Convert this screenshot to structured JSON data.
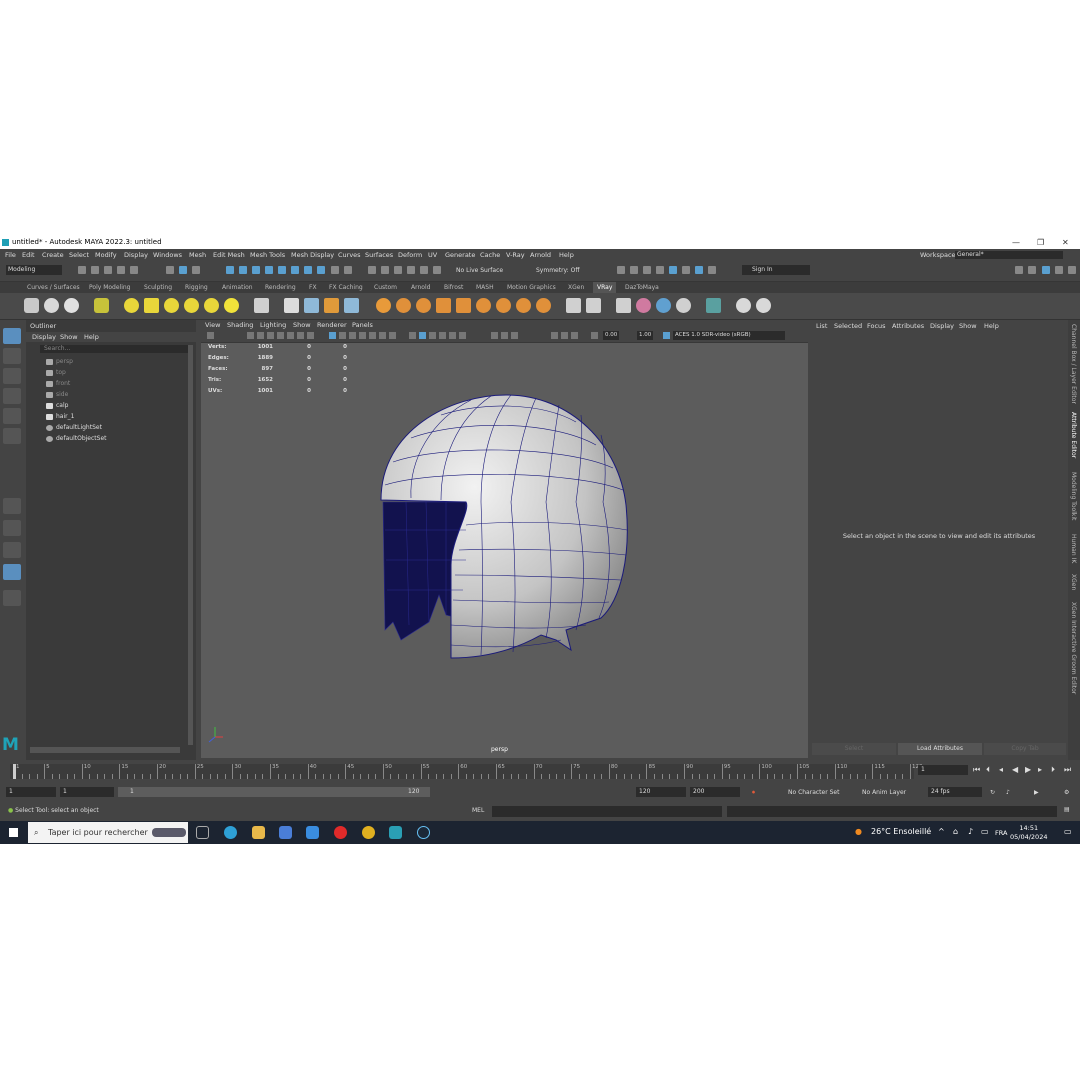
{
  "window": {
    "title": "untitled* - Autodesk MAYA 2022.3: untitled"
  },
  "menubar": {
    "items": [
      "File",
      "Edit",
      "Create",
      "Select",
      "Modify",
      "Display",
      "Windows",
      "Mesh",
      "Edit Mesh",
      "Mesh Tools",
      "Mesh Display",
      "Curves",
      "Surfaces",
      "Deform",
      "UV",
      "Generate",
      "Cache",
      "V-Ray",
      "Arnold",
      "Help"
    ],
    "workspace_label": "Workspace:",
    "workspace_value": "General*"
  },
  "statusline": {
    "mode": "Modeling",
    "live_surface": "No Live Surface",
    "symmetry": "Symmetry: Off",
    "sign_in": "Sign In"
  },
  "shelf": {
    "tabs": [
      "Curves / Surfaces",
      "Poly Modeling",
      "Sculpting",
      "Rigging",
      "Animation",
      "Rendering",
      "FX",
      "FX Caching",
      "Custom",
      "Arnold",
      "Bifrost",
      "MASH",
      "Motion Graphics",
      "XGen",
      "VRay",
      "DazToMaya"
    ],
    "active_tab": "VRay"
  },
  "outliner": {
    "title": "Outliner",
    "menu": [
      "Display",
      "Show",
      "Help"
    ],
    "search_placeholder": "Search...",
    "items": [
      {
        "label": "persp",
        "dim": true,
        "icon": "camera-icon"
      },
      {
        "label": "top",
        "dim": true,
        "icon": "camera-icon"
      },
      {
        "label": "front",
        "dim": true,
        "icon": "camera-icon"
      },
      {
        "label": "side",
        "dim": true,
        "icon": "camera-icon"
      },
      {
        "label": "calp",
        "dim": false,
        "icon": "transform-icon"
      },
      {
        "label": "hair_1",
        "dim": false,
        "icon": "transform-icon"
      },
      {
        "label": "defaultLightSet",
        "dim": false,
        "icon": "set-icon"
      },
      {
        "label": "defaultObjectSet",
        "dim": false,
        "icon": "set-icon"
      }
    ]
  },
  "viewport": {
    "menu": [
      "View",
      "Shading",
      "Lighting",
      "Show",
      "Renderer",
      "Panels"
    ],
    "value_a": "0.00",
    "value_b": "1.00",
    "colorspace": "ACES 1.0 SDR-video (sRGB)",
    "hud": [
      {
        "label": "Verts:",
        "v1": "1001",
        "v2": "0",
        "v3": "0"
      },
      {
        "label": "Edges:",
        "v1": "1889",
        "v2": "0",
        "v3": "0"
      },
      {
        "label": "Faces:",
        "v1": "897",
        "v2": "0",
        "v3": "0"
      },
      {
        "label": "Tris:",
        "v1": "1652",
        "v2": "0",
        "v3": "0"
      },
      {
        "label": "UVs:",
        "v1": "1001",
        "v2": "0",
        "v3": "0"
      }
    ],
    "camera": "persp",
    "mesh_color": "#1a1a7a"
  },
  "attribute_editor": {
    "menu": [
      "List",
      "Selected",
      "Focus",
      "Attributes",
      "Display",
      "Show",
      "Help"
    ],
    "message": "Select an object in the scene to view and edit its attributes",
    "buttons": {
      "select": "Select",
      "load": "Load Attributes",
      "copy": "Copy Tab"
    }
  },
  "side_tabs": [
    "Channel Box / Layer Editor",
    "Attribute Editor",
    "Modeling Toolkit",
    "Human IK",
    "XGen",
    "XGen Interactive Groom Editor"
  ],
  "time_slider": {
    "ticks": [
      1,
      5,
      10,
      15,
      20,
      25,
      30,
      35,
      40,
      45,
      50,
      55,
      60,
      65,
      70,
      75,
      80,
      85,
      90,
      95,
      100,
      105,
      110,
      115,
      120
    ],
    "current_frame": "1"
  },
  "range": {
    "start": "1",
    "inner_start": "1",
    "slider_start": "1",
    "slider_end": "120",
    "end": "120",
    "total_end": "200",
    "character_set": "No Character Set",
    "anim_layer": "No Anim Layer",
    "fps": "24 fps"
  },
  "command": {
    "help_text": "Select Tool: select an object",
    "mel": "MEL"
  },
  "taskbar": {
    "search_placeholder": "Taper ici pour rechercher",
    "weather": "26°C Ensoleillé",
    "language": "FRA",
    "time": "14:51",
    "date": "05/04/2024"
  }
}
